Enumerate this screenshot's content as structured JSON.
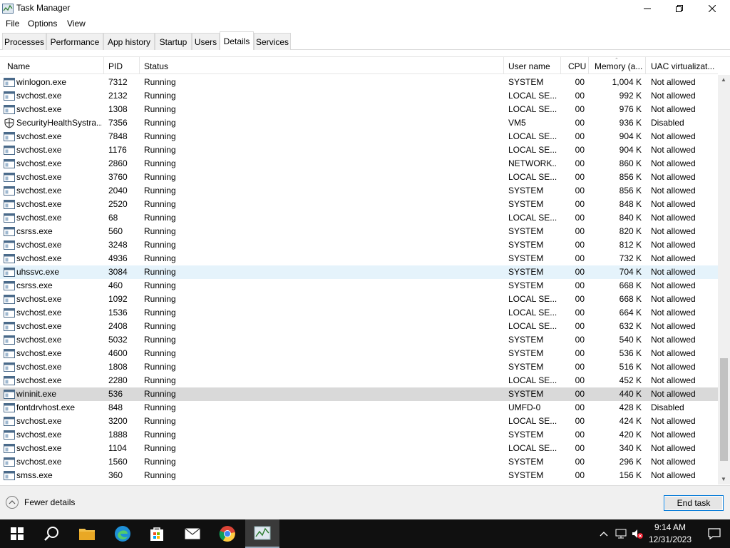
{
  "window": {
    "title": "Task Manager",
    "icon": "task-manager-icon"
  },
  "menu": [
    "File",
    "Options",
    "View"
  ],
  "tabs": [
    {
      "label": "Processes",
      "active": false
    },
    {
      "label": "Performance",
      "active": false
    },
    {
      "label": "App history",
      "active": false
    },
    {
      "label": "Startup",
      "active": false
    },
    {
      "label": "Users",
      "active": false
    },
    {
      "label": "Details",
      "active": true
    },
    {
      "label": "Services",
      "active": false
    }
  ],
  "table": {
    "headers": {
      "name": "Name",
      "pid": "PID",
      "status": "Status",
      "user": "User name",
      "cpu": "CPU",
      "memory": "Memory (a...",
      "uac": "UAC virtualizat..."
    },
    "rows": [
      {
        "name": "winlogon.exe",
        "pid": "7312",
        "status": "Running",
        "user": "SYSTEM",
        "cpu": "00",
        "memory": "1,004 K",
        "uac": "Not allowed",
        "icon": "process-icon"
      },
      {
        "name": "svchost.exe",
        "pid": "2132",
        "status": "Running",
        "user": "LOCAL SE...",
        "cpu": "00",
        "memory": "992 K",
        "uac": "Not allowed",
        "icon": "process-icon"
      },
      {
        "name": "svchost.exe",
        "pid": "1308",
        "status": "Running",
        "user": "LOCAL SE...",
        "cpu": "00",
        "memory": "976 K",
        "uac": "Not allowed",
        "icon": "process-icon"
      },
      {
        "name": "SecurityHealthSystra...",
        "pid": "7356",
        "status": "Running",
        "user": "VM5",
        "cpu": "00",
        "memory": "936 K",
        "uac": "Disabled",
        "icon": "shield-icon"
      },
      {
        "name": "svchost.exe",
        "pid": "7848",
        "status": "Running",
        "user": "LOCAL SE...",
        "cpu": "00",
        "memory": "904 K",
        "uac": "Not allowed",
        "icon": "process-icon"
      },
      {
        "name": "svchost.exe",
        "pid": "1176",
        "status": "Running",
        "user": "LOCAL SE...",
        "cpu": "00",
        "memory": "904 K",
        "uac": "Not allowed",
        "icon": "process-icon"
      },
      {
        "name": "svchost.exe",
        "pid": "2860",
        "status": "Running",
        "user": "NETWORK...",
        "cpu": "00",
        "memory": "860 K",
        "uac": "Not allowed",
        "icon": "process-icon"
      },
      {
        "name": "svchost.exe",
        "pid": "3760",
        "status": "Running",
        "user": "LOCAL SE...",
        "cpu": "00",
        "memory": "856 K",
        "uac": "Not allowed",
        "icon": "process-icon"
      },
      {
        "name": "svchost.exe",
        "pid": "2040",
        "status": "Running",
        "user": "SYSTEM",
        "cpu": "00",
        "memory": "856 K",
        "uac": "Not allowed",
        "icon": "process-icon"
      },
      {
        "name": "svchost.exe",
        "pid": "2520",
        "status": "Running",
        "user": "SYSTEM",
        "cpu": "00",
        "memory": "848 K",
        "uac": "Not allowed",
        "icon": "process-icon"
      },
      {
        "name": "svchost.exe",
        "pid": "68",
        "status": "Running",
        "user": "LOCAL SE...",
        "cpu": "00",
        "memory": "840 K",
        "uac": "Not allowed",
        "icon": "process-icon"
      },
      {
        "name": "csrss.exe",
        "pid": "560",
        "status": "Running",
        "user": "SYSTEM",
        "cpu": "00",
        "memory": "820 K",
        "uac": "Not allowed",
        "icon": "process-icon"
      },
      {
        "name": "svchost.exe",
        "pid": "3248",
        "status": "Running",
        "user": "SYSTEM",
        "cpu": "00",
        "memory": "812 K",
        "uac": "Not allowed",
        "icon": "process-icon"
      },
      {
        "name": "svchost.exe",
        "pid": "4936",
        "status": "Running",
        "user": "SYSTEM",
        "cpu": "00",
        "memory": "732 K",
        "uac": "Not allowed",
        "icon": "process-icon"
      },
      {
        "name": "uhssvc.exe",
        "pid": "3084",
        "status": "Running",
        "user": "SYSTEM",
        "cpu": "00",
        "memory": "704 K",
        "uac": "Not allowed",
        "icon": "process-icon",
        "state": "hover"
      },
      {
        "name": "csrss.exe",
        "pid": "460",
        "status": "Running",
        "user": "SYSTEM",
        "cpu": "00",
        "memory": "668 K",
        "uac": "Not allowed",
        "icon": "process-icon"
      },
      {
        "name": "svchost.exe",
        "pid": "1092",
        "status": "Running",
        "user": "LOCAL SE...",
        "cpu": "00",
        "memory": "668 K",
        "uac": "Not allowed",
        "icon": "process-icon"
      },
      {
        "name": "svchost.exe",
        "pid": "1536",
        "status": "Running",
        "user": "LOCAL SE...",
        "cpu": "00",
        "memory": "664 K",
        "uac": "Not allowed",
        "icon": "process-icon"
      },
      {
        "name": "svchost.exe",
        "pid": "2408",
        "status": "Running",
        "user": "LOCAL SE...",
        "cpu": "00",
        "memory": "632 K",
        "uac": "Not allowed",
        "icon": "process-icon"
      },
      {
        "name": "svchost.exe",
        "pid": "5032",
        "status": "Running",
        "user": "SYSTEM",
        "cpu": "00",
        "memory": "540 K",
        "uac": "Not allowed",
        "icon": "process-icon"
      },
      {
        "name": "svchost.exe",
        "pid": "4600",
        "status": "Running",
        "user": "SYSTEM",
        "cpu": "00",
        "memory": "536 K",
        "uac": "Not allowed",
        "icon": "process-icon"
      },
      {
        "name": "svchost.exe",
        "pid": "1808",
        "status": "Running",
        "user": "SYSTEM",
        "cpu": "00",
        "memory": "516 K",
        "uac": "Not allowed",
        "icon": "process-icon"
      },
      {
        "name": "svchost.exe",
        "pid": "2280",
        "status": "Running",
        "user": "LOCAL SE...",
        "cpu": "00",
        "memory": "452 K",
        "uac": "Not allowed",
        "icon": "process-icon"
      },
      {
        "name": "wininit.exe",
        "pid": "536",
        "status": "Running",
        "user": "SYSTEM",
        "cpu": "00",
        "memory": "440 K",
        "uac": "Not allowed",
        "icon": "process-icon",
        "state": "selected"
      },
      {
        "name": "fontdrvhost.exe",
        "pid": "848",
        "status": "Running",
        "user": "UMFD-0",
        "cpu": "00",
        "memory": "428 K",
        "uac": "Disabled",
        "icon": "process-icon"
      },
      {
        "name": "svchost.exe",
        "pid": "3200",
        "status": "Running",
        "user": "LOCAL SE...",
        "cpu": "00",
        "memory": "424 K",
        "uac": "Not allowed",
        "icon": "process-icon"
      },
      {
        "name": "svchost.exe",
        "pid": "1888",
        "status": "Running",
        "user": "SYSTEM",
        "cpu": "00",
        "memory": "420 K",
        "uac": "Not allowed",
        "icon": "process-icon"
      },
      {
        "name": "svchost.exe",
        "pid": "1104",
        "status": "Running",
        "user": "LOCAL SE...",
        "cpu": "00",
        "memory": "340 K",
        "uac": "Not allowed",
        "icon": "process-icon"
      },
      {
        "name": "svchost.exe",
        "pid": "1560",
        "status": "Running",
        "user": "SYSTEM",
        "cpu": "00",
        "memory": "296 K",
        "uac": "Not allowed",
        "icon": "process-icon"
      },
      {
        "name": "smss.exe",
        "pid": "360",
        "status": "Running",
        "user": "SYSTEM",
        "cpu": "00",
        "memory": "156 K",
        "uac": "Not allowed",
        "icon": "process-icon"
      }
    ]
  },
  "footer": {
    "fewer_details": "Fewer details",
    "end_task": "End task"
  },
  "taskbar": {
    "items": [
      "start-icon",
      "search-icon",
      "file-explorer-icon",
      "edge-icon",
      "store-icon",
      "mail-icon",
      "chrome-icon",
      "task-manager-icon"
    ],
    "active_item": "task-manager-icon",
    "time": "9:14 AM",
    "date": "12/31/2023"
  },
  "colors": {
    "selected_row": "#d9d9d9",
    "hover_row": "#e5f3fb",
    "taskbar": "#101010",
    "accent": "#0078d7"
  }
}
